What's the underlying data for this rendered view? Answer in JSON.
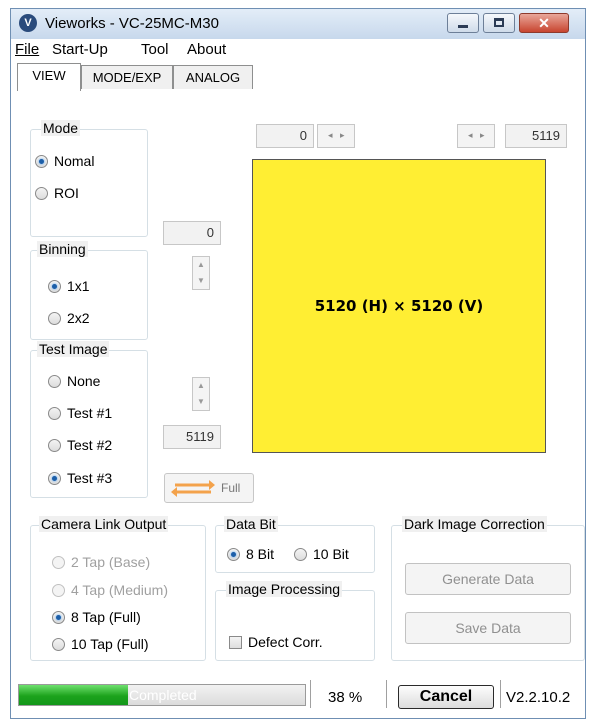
{
  "window": {
    "title": "Vieworks - VC-25MC-M30",
    "logo_glyph": "V"
  },
  "menu": [
    {
      "label": "File"
    },
    {
      "label": "Start-Up"
    },
    {
      "label": "Tool"
    },
    {
      "label": "About"
    }
  ],
  "tabs": [
    {
      "label": "VIEW",
      "active": true
    },
    {
      "label": "MODE/EXP",
      "active": false
    },
    {
      "label": "ANALOG",
      "active": false
    }
  ],
  "mode": {
    "title": "Mode",
    "options": [
      {
        "label": "Nomal",
        "selected": true
      },
      {
        "label": "ROI",
        "selected": false
      }
    ]
  },
  "binning": {
    "title": "Binning",
    "options": [
      {
        "label": "1x1",
        "selected": true
      },
      {
        "label": "2x2",
        "selected": false
      }
    ]
  },
  "test_image": {
    "title": "Test Image",
    "options": [
      {
        "label": "None",
        "selected": false
      },
      {
        "label": "Test #1",
        "selected": false
      },
      {
        "label": "Test #2",
        "selected": false
      },
      {
        "label": "Test #3",
        "selected": true
      }
    ]
  },
  "roi": {
    "x_start": "0",
    "x_end": "5119",
    "y_start": "0",
    "y_end": "5119",
    "full_label": "Full"
  },
  "canvas": {
    "label": "5120 (H) × 5120 (V)",
    "color": "#ffee33"
  },
  "camera_link": {
    "title": "Camera Link Output",
    "options": [
      {
        "label": "2 Tap (Base)",
        "selected": false,
        "disabled": true
      },
      {
        "label": "4 Tap (Medium)",
        "selected": false,
        "disabled": true
      },
      {
        "label": "8 Tap (Full)",
        "selected": true,
        "disabled": false
      },
      {
        "label": "10 Tap (Full)",
        "selected": false,
        "disabled": false
      }
    ]
  },
  "data_bit": {
    "title": "Data Bit",
    "options": [
      {
        "label": "8 Bit",
        "selected": true
      },
      {
        "label": "10 Bit",
        "selected": false
      }
    ]
  },
  "image_processing": {
    "title": "Image Processing",
    "defect_label": "Defect Corr.",
    "defect_checked": false
  },
  "dark_image": {
    "title": "Dark Image Correction",
    "generate_label": "Generate Data",
    "save_label": "Save Data"
  },
  "status": {
    "progress_text": "Completed",
    "progress_value": 0.38,
    "percent": "38 %",
    "cancel_label": "Cancel",
    "version": "V2.2.10.2"
  }
}
